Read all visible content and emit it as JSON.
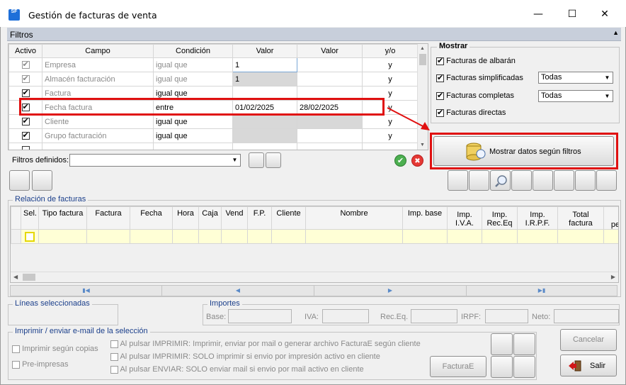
{
  "window": {
    "title": "Gestión de facturas de venta",
    "icon_text": "SF",
    "minimize": "—",
    "maximize": "☐",
    "close": "✕"
  },
  "filters_bar": {
    "label": "Filtros",
    "collapse_icon": "▲"
  },
  "filters_grid": {
    "headers": [
      "Activo",
      "Campo",
      "Condición",
      "Valor",
      "Valor",
      "y/o"
    ],
    "rows": [
      {
        "active": true,
        "enabled": false,
        "field": "Empresa",
        "condition": "igual que",
        "value1": "1",
        "value2": "",
        "yo": "y"
      },
      {
        "active": true,
        "enabled": false,
        "field": "Almacén facturación",
        "condition": "igual que",
        "value1": "1",
        "value2": "",
        "yo": "y"
      },
      {
        "active": true,
        "enabled": true,
        "field": "Factura",
        "condition": "igual que",
        "value1": "",
        "value2": "",
        "yo": "y"
      },
      {
        "active": true,
        "enabled": true,
        "field": "Fecha factura",
        "condition": "entre",
        "value1": "01/02/2025",
        "value2": "28/02/2025",
        "yo": "y"
      },
      {
        "active": true,
        "enabled": true,
        "field": "Cliente",
        "condition": "igual que",
        "value1": "",
        "value2": "",
        "yo": "y"
      },
      {
        "active": true,
        "enabled": true,
        "field": "Grupo facturación",
        "condition": "igual que",
        "value1": "",
        "value2": "",
        "yo": "y"
      }
    ]
  },
  "defined_filters": {
    "label": "Filtros definidos:",
    "value": ""
  },
  "mostrar": {
    "title": "Mostrar",
    "albaran": "Facturas de albarán",
    "simplificadas": "Facturas simplificadas",
    "simplificadas_value": "Todas",
    "completas": "Facturas completas",
    "completas_value": "Todas",
    "directas": "Facturas directas"
  },
  "show_button": {
    "label": "Mostrar datos según filtros"
  },
  "invoices": {
    "title": "Relación de facturas",
    "columns": [
      "Sel.",
      "Tipo factura",
      "Factura",
      "Fecha",
      "Hora",
      "Caja",
      "Vend",
      "F.P.",
      "Cliente",
      "Nombre",
      "Imp. base",
      "Imp.\nI.V.A.",
      "Imp.\nRec.Eq",
      "Imp.\nI.R.P.F.",
      "Total\nfactura",
      "pe"
    ]
  },
  "nav": {
    "first": "▮◀",
    "prev": "◀",
    "next": "▶",
    "last": "▶▮"
  },
  "selected_lines": {
    "title": "Líneas seleccionadas"
  },
  "importes": {
    "title": "Importes",
    "base": "Base:",
    "iva": "IVA:",
    "receq": "Rec.Eq.",
    "irpf": "IRPF:",
    "neto": "Neto:"
  },
  "print_section": {
    "title": "Imprimir / enviar e-mail de la selección",
    "copias": "Imprimir según copias",
    "preimpresas": "Pre-impresas",
    "opt1": "Al pulsar IMPRIMIR: Imprimir, enviar por mail o generar archivo FacturaE según cliente",
    "opt2": "Al pulsar IMPRIMIR: SOLO imprimir si envio por impresión activo en cliente",
    "opt3": "Al pulsar ENVIAR: SOLO enviar mail si envio por mail activo en cliente",
    "facturae": "FacturaE"
  },
  "actions": {
    "cancel": "Cancelar",
    "exit": "Salir"
  },
  "colors": {
    "highlight": "#e01010",
    "header_bar": "#c8cfdb",
    "group_title": "#1b3f8b",
    "selected_row": "#ffffd6"
  }
}
